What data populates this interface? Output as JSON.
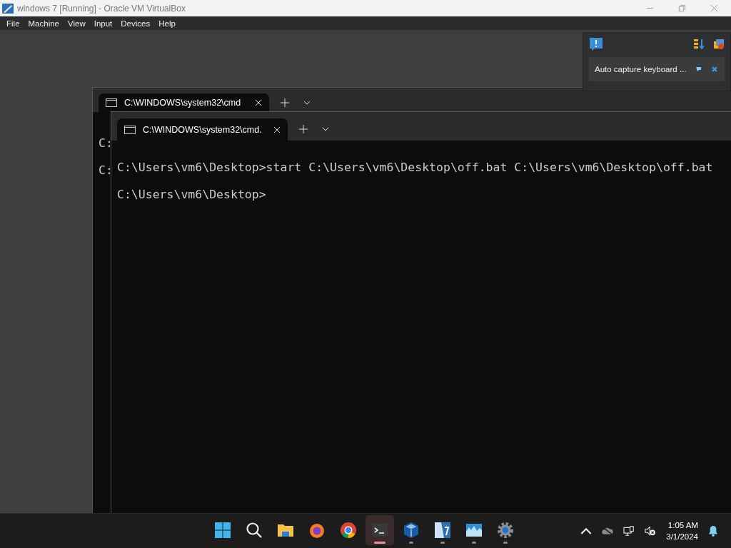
{
  "window": {
    "title": "windows 7 [Running] - Oracle VM VirtualBox"
  },
  "menu": [
    "File",
    "Machine",
    "View",
    "Input",
    "Devices",
    "Help"
  ],
  "notification_panel": {
    "message": "Auto capture keyboard ..."
  },
  "back_terminal": {
    "tab_title": "C:\\WINDOWS\\system32\\cmd",
    "lines": [
      "C:",
      "C:"
    ]
  },
  "front_terminal": {
    "tab_title": "C:\\WINDOWS\\system32\\cmd.",
    "lines": [
      "C:\\Users\\vm6\\Desktop>start C:\\Users\\vm6\\Desktop\\off.bat C:\\Users\\vm6\\Desktop\\off.bat",
      "C:\\Users\\vm6\\Desktop>"
    ]
  },
  "taskbar": {
    "apps": [
      {
        "kind": "start",
        "running": false,
        "selected": false
      },
      {
        "kind": "search",
        "running": false,
        "selected": false
      },
      {
        "kind": "folder",
        "running": false,
        "selected": false
      },
      {
        "kind": "firefox",
        "running": false,
        "selected": false
      },
      {
        "kind": "chrome",
        "running": false,
        "selected": false
      },
      {
        "kind": "terminal",
        "running": true,
        "selected": true
      },
      {
        "kind": "cube",
        "running": true,
        "selected": false
      },
      {
        "kind": "seven",
        "running": true,
        "selected": false
      },
      {
        "kind": "mountains",
        "running": true,
        "selected": false
      },
      {
        "kind": "gear",
        "running": true,
        "selected": false
      }
    ],
    "time": "1:05 AM",
    "date": "3/1/2024"
  }
}
